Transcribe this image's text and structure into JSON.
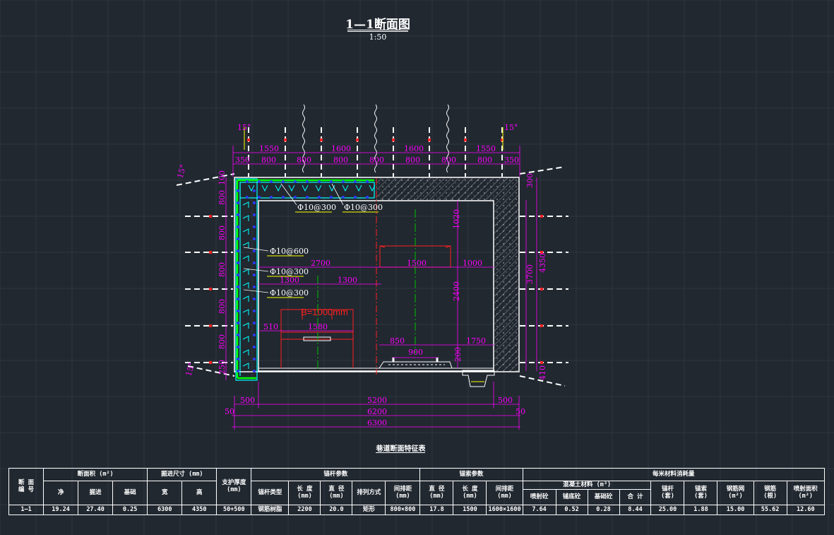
{
  "drawing": {
    "title": "1—1断面图",
    "scale": "1:50",
    "caption": "巷道断面特征表"
  },
  "colors": {
    "background": "#212830",
    "grid": "#2e3640",
    "dimension": "#ff00ff",
    "lining": "#00ffff",
    "bolt_dot": "#2a3bff",
    "centerline": "#00c000",
    "red": "#ff2020",
    "rebar_underline": "#ffff00",
    "white": "#ffffff"
  },
  "dims": {
    "top_1550_left": "1550",
    "top_1600_a": "1600",
    "top_1600_b": "1600",
    "top_1550_right": "1550",
    "top_350_left": "350",
    "top_800_1": "800",
    "top_800_2": "800",
    "top_800_3": "800",
    "top_800_4": "800",
    "top_800_5": "800",
    "top_800_6": "800",
    "top_800_7": "800",
    "top_350_right": "350",
    "angle_tl": "15°",
    "angle_tr": "15°",
    "angle_lt": "15°",
    "angle_lb": "15°",
    "left_100": "100",
    "left_800_1": "800",
    "left_800_2": "800",
    "left_800_3": "800",
    "left_800_4": "800",
    "left_800_5": "800",
    "left_250": "250",
    "right_300": "300",
    "right_3700": "3700",
    "right_4350": "4350",
    "right_410": "410",
    "w_2700": "2700",
    "w_1300_a": "1300",
    "w_1300_b": "1300",
    "w_1500": "1500",
    "w_1000": "1000",
    "h_1020": "1020",
    "h_2400": "2400",
    "w_510": "510",
    "w_1580": "1580",
    "w_850": "850",
    "w_900": "900",
    "w_1750": "1750",
    "h_200": "200",
    "bottom_500_l": "500",
    "bottom_5200": "5200",
    "bottom_500_r": "500",
    "bottom_50_l": "50",
    "bottom_6200": "6200",
    "bottom_50_r": "50",
    "bottom_6300": "6300",
    "belt": "B=1000mm"
  },
  "rebar": {
    "r1": "Φ10@300",
    "r2": "Φ10@300",
    "r3": "Φ10@600",
    "r4": "Φ10@300",
    "r5": "Φ10@300"
  },
  "table": {
    "h_section_no": "断 面\n编 号",
    "h_area": "断面积 (m²)",
    "h_area_net": "净",
    "h_area_exc": "掘进",
    "h_area_base": "基础",
    "h_size": "掘进尺寸 (mm)",
    "h_width": "宽",
    "h_height": "高",
    "h_support": "支护厚度\n(mm)",
    "h_bolt": "锚杆参数",
    "h_bolt_type": "锚杆类型",
    "h_bolt_len": "长 度\n(mm)",
    "h_bolt_dia": "直 径\n(mm)",
    "h_bolt_arr": "排列方式",
    "h_bolt_sp": "间排距 (mm)",
    "h_cable": "锚索参数",
    "h_cable_dia": "直 径\n(mm)",
    "h_cable_len": "长 度\n(mm)",
    "h_cable_sp": "间排距 (mm)",
    "h_mat": "每米材料消耗量",
    "h_concrete": "混凝土材料 (m³)",
    "h_spray": "喷射砼",
    "h_pour": "铺底砼",
    "h_basec": "基础砼",
    "h_total": "合 计",
    "h_bolts": "锚杆\n(套)",
    "h_cables": "锚索\n(套)",
    "h_mesh": "钢筋网\n(m²)",
    "h_rebar": "钢筋\n(根)",
    "h_spray_area": "喷射面积\n(m²)",
    "row": [
      "1—1",
      "19.24",
      "27.40",
      "0.25",
      "6300",
      "4350",
      "50+500",
      "钢筋树脂",
      "2200",
      "20.0",
      "矩形",
      "800×800",
      "17.8",
      "1500",
      "1600×1600",
      "7.64",
      "0.52",
      "0.28",
      "8.44",
      "25.00",
      "1.88",
      "15.00",
      "55.62",
      "12.60"
    ]
  }
}
